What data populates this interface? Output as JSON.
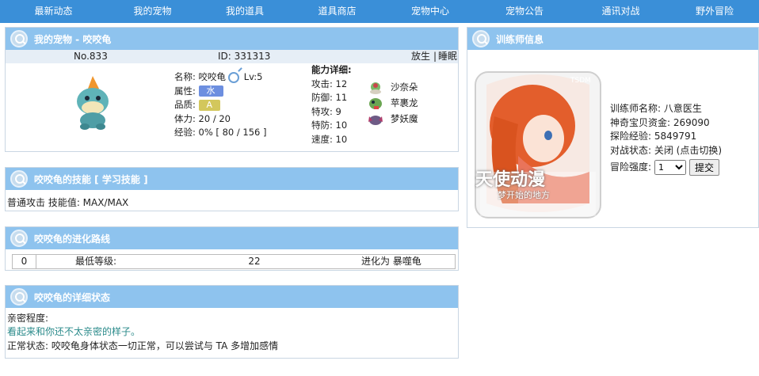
{
  "nav": [
    "最新动态",
    "我的宠物",
    "我的道具",
    "道具商店",
    "宠物中心",
    "宠物公告",
    "通讯对战",
    "野外冒险"
  ],
  "pet_panel": {
    "title": "我的宠物 - 咬咬龟",
    "number": "No.833",
    "id": "ID: 331313",
    "release": "放生",
    "separator": "|",
    "sleep": "睡眠",
    "name_label": "名称:",
    "name": "咬咬龟",
    "level": "Lv:5",
    "attr_label": "属性:",
    "attr": "水",
    "quality_label": "品质:",
    "quality": "A",
    "hp_label": "体力:",
    "hp": "20 / 20",
    "exp_label": "经验:",
    "exp": "0% [ 80 / 156 ]",
    "stats_title": "能力详细:",
    "stats": [
      "攻击: 12",
      "防御: 11",
      "特攻: 9",
      "特防: 10",
      "速度: 10"
    ],
    "evolutions": [
      "沙奈朵",
      "苹裹龙",
      "梦妖魔"
    ]
  },
  "skills_panel": {
    "title_prefix": "咬咬龟的技能 [",
    "learn_link": "学习技能",
    "title_suffix": "]",
    "skill_line": "普通攻击 技能值: MAX/MAX"
  },
  "evo_panel": {
    "title": "咬咬龟的进化路线",
    "row": {
      "index": "0",
      "label": "最低等级:",
      "level": "22",
      "target": "进化为 暴噬龟"
    }
  },
  "status_panel": {
    "title": "咬咬龟的详细状态",
    "intimacy_label": "亲密程度:",
    "intimacy_text": "看起来和你还不太亲密的样子。",
    "normal_text": "正常状态: 咬咬龟身体状态一切正常，可以尝试与 TA 多增加感情"
  },
  "trainer_panel": {
    "title": "训练师信息",
    "avatar_text_main": "天使动漫",
    "avatar_text_sub": "梦开始的地方",
    "avatar_watermark": "TSDM",
    "name": "训练师名称: 八意医生",
    "money": "神奇宝贝资金: 269090",
    "exp": "探险经验: 5849791",
    "battle": "对战状态: 关闭  (点击切换)",
    "intensity_label": "冒险强度:",
    "intensity_value": "1",
    "submit": "提交"
  },
  "colors": {
    "nav": "#3a8fd8",
    "panel_head": "#8ec3ee",
    "info_bar": "#e6eef6",
    "link_green": "#2a8a8a"
  }
}
